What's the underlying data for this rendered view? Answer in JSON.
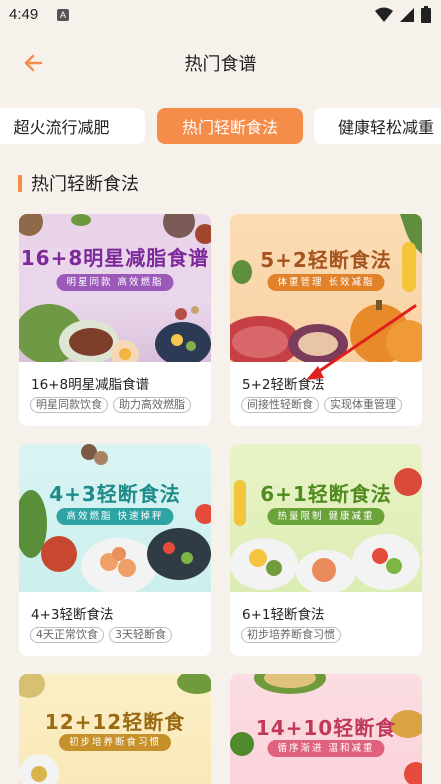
{
  "status": {
    "time": "4:49",
    "a_badge": "A"
  },
  "header": {
    "title": "热门食谱"
  },
  "tabs": [
    {
      "label": "超火流行减肥",
      "active": false
    },
    {
      "label": "热门轻断食法",
      "active": true
    },
    {
      "label": "健康轻松减重",
      "active": false
    }
  ],
  "section": {
    "title": "热门轻断食法"
  },
  "cards": [
    {
      "banner_title": "16+8明星减脂食谱",
      "banner_sub": "明星同款  高效燃脂",
      "title": "16+8明星减脂食谱",
      "tags": [
        "明星同款饮食",
        "助力高效燃脂"
      ]
    },
    {
      "banner_title": "5+2轻断食法",
      "banner_sub": "体重管理  长效减脂",
      "title": "5+2轻断食法",
      "tags": [
        "间接性轻断食",
        "实现体重管理"
      ]
    },
    {
      "banner_title": "4+3轻断食法",
      "banner_sub": "高效燃脂  快速掉秤",
      "title": "4+3轻断食法",
      "tags": [
        "4天正常饮食",
        "3天轻断食"
      ]
    },
    {
      "banner_title": "6+1轻断食法",
      "banner_sub": "热量限制  健康减重",
      "title": "6+1轻断食法",
      "tags": [
        "初步培养断食习惯"
      ]
    },
    {
      "banner_title": "12+12轻断食",
      "banner_sub": "初步培养断食习惯"
    },
    {
      "banner_title": "14+10轻断食",
      "banner_sub": "循序渐进  温和减重"
    }
  ],
  "colors": {
    "accent": "#f68c4a",
    "background": "#f7f1ec"
  }
}
